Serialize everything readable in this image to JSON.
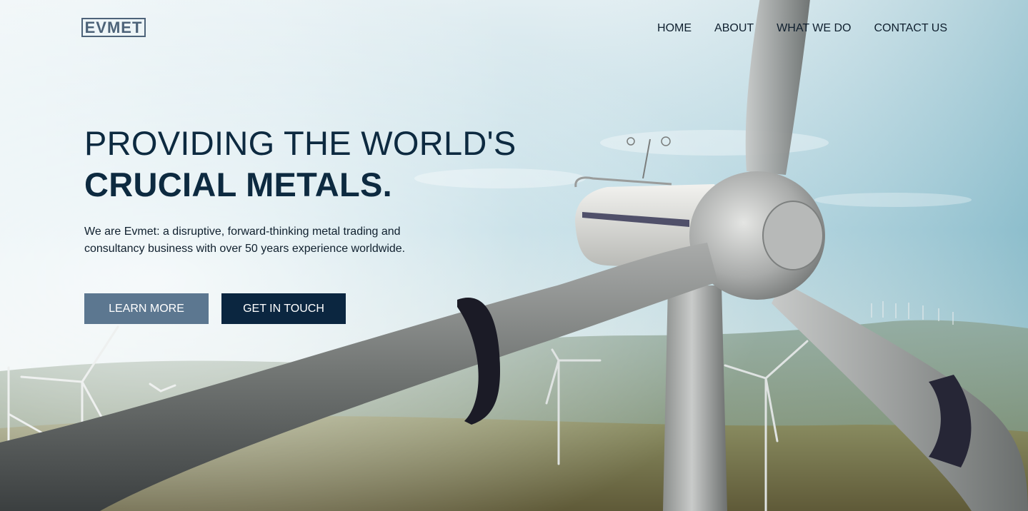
{
  "brand": {
    "logo_text": "EVMET"
  },
  "nav": {
    "items": [
      {
        "label": "HOME"
      },
      {
        "label": "ABOUT"
      },
      {
        "label": "WHAT WE DO"
      },
      {
        "label": "CONTACT US"
      }
    ]
  },
  "hero": {
    "headline_line1": "PROVIDING THE WORLD'S",
    "headline_line2": "CRUCIAL METALS.",
    "tagline": "We are Evmet: a disruptive, forward-thinking metal trading and consultancy business with over 50 years experience worldwide.",
    "learn_more_label": "LEARN MORE",
    "get_in_touch_label": "GET IN TOUCH"
  },
  "colors": {
    "primary_dark": "#0b2640",
    "secondary_button": "#5c7790",
    "text_dark": "#0d2a40"
  }
}
